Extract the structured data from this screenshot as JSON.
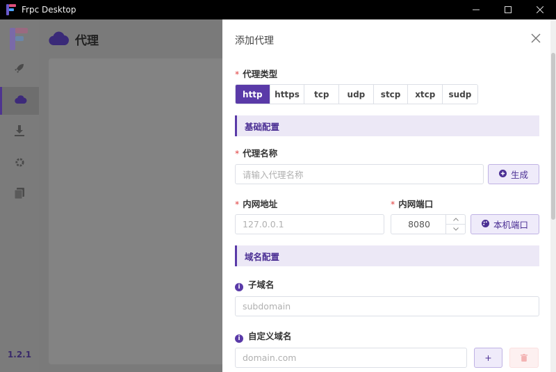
{
  "window": {
    "title": "Frpc Desktop"
  },
  "sidebar": {
    "version": "1.2.1",
    "items": [
      {
        "icon": "rocket-icon"
      },
      {
        "icon": "cloud-icon",
        "active": true
      },
      {
        "icon": "download-icon"
      },
      {
        "icon": "gear-icon"
      },
      {
        "icon": "document-icon"
      }
    ]
  },
  "main": {
    "title": "代理"
  },
  "drawer": {
    "title": "添加代理",
    "proxy_type": {
      "label": "代理类型",
      "options": [
        "http",
        "https",
        "tcp",
        "udp",
        "stcp",
        "xtcp",
        "sudp"
      ],
      "selected": "http"
    },
    "basic_section": "基础配置",
    "proxy_name": {
      "label": "代理名称",
      "placeholder": "请输入代理名称",
      "generate_label": "生成"
    },
    "local_ip": {
      "label": "内网地址",
      "placeholder": "127.0.0.1"
    },
    "local_port": {
      "label": "内网端口",
      "value": "8080",
      "local_port_button": "本机端口"
    },
    "domain_section": "域名配置",
    "subdomain": {
      "label": "子域名",
      "placeholder": "subdomain"
    },
    "custom_domain": {
      "label": "自定义域名",
      "placeholder": "domain.com",
      "add_label": "+"
    }
  },
  "colors": {
    "accent": "#5a3aa8",
    "accent_light": "#ece8f6",
    "danger": "#f56c6c"
  }
}
